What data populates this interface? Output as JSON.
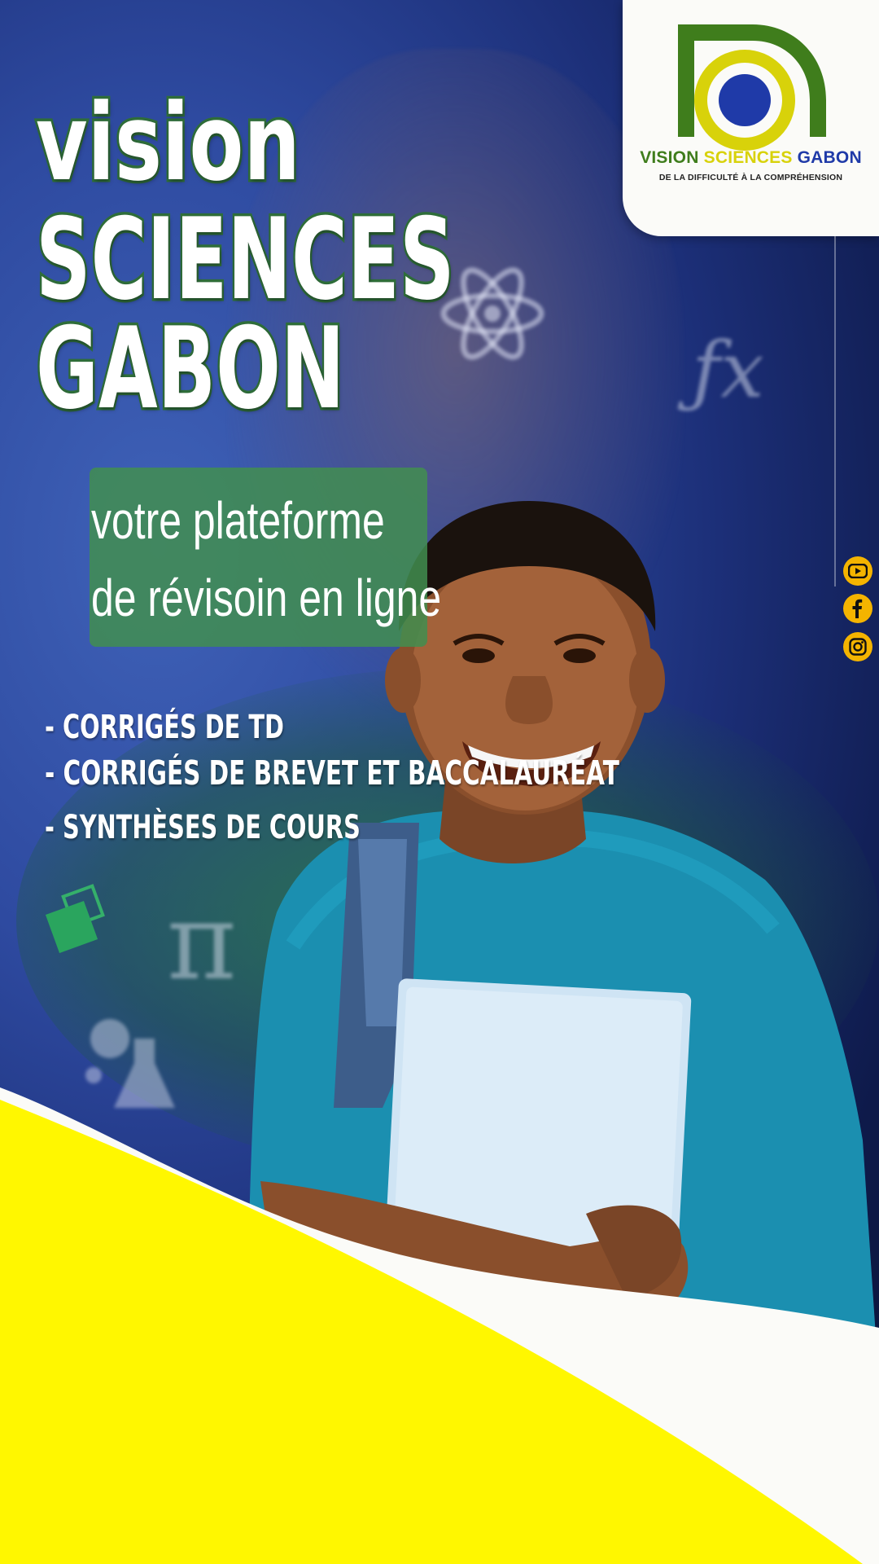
{
  "logo": {
    "name_part1": "VISION",
    "name_part2": "SCIENCES",
    "name_part3": "GABON",
    "tagline": "DE LA DIFFICULTÉ À LA COMPRÉHENSION"
  },
  "title": {
    "line1": "vision",
    "line2": "SCIENCES",
    "line3": "GABON"
  },
  "subtitle": {
    "line1": "votre plateforme",
    "line2": "de révisoin en ligne"
  },
  "features": [
    "- CORRIGÉS DE TD",
    "- CORRIGÉS  DE BREVET ET BACCALAURÉAT",
    "- SYNTHÈSES DE COURS"
  ],
  "social": [
    "youtube-icon",
    "facebook-icon",
    "instagram-icon"
  ],
  "colors": {
    "brand_green": "#3f7d1c",
    "brand_yellow": "#fff700",
    "brand_blue": "#1f3aa8",
    "social_gold": "#f4b400"
  }
}
